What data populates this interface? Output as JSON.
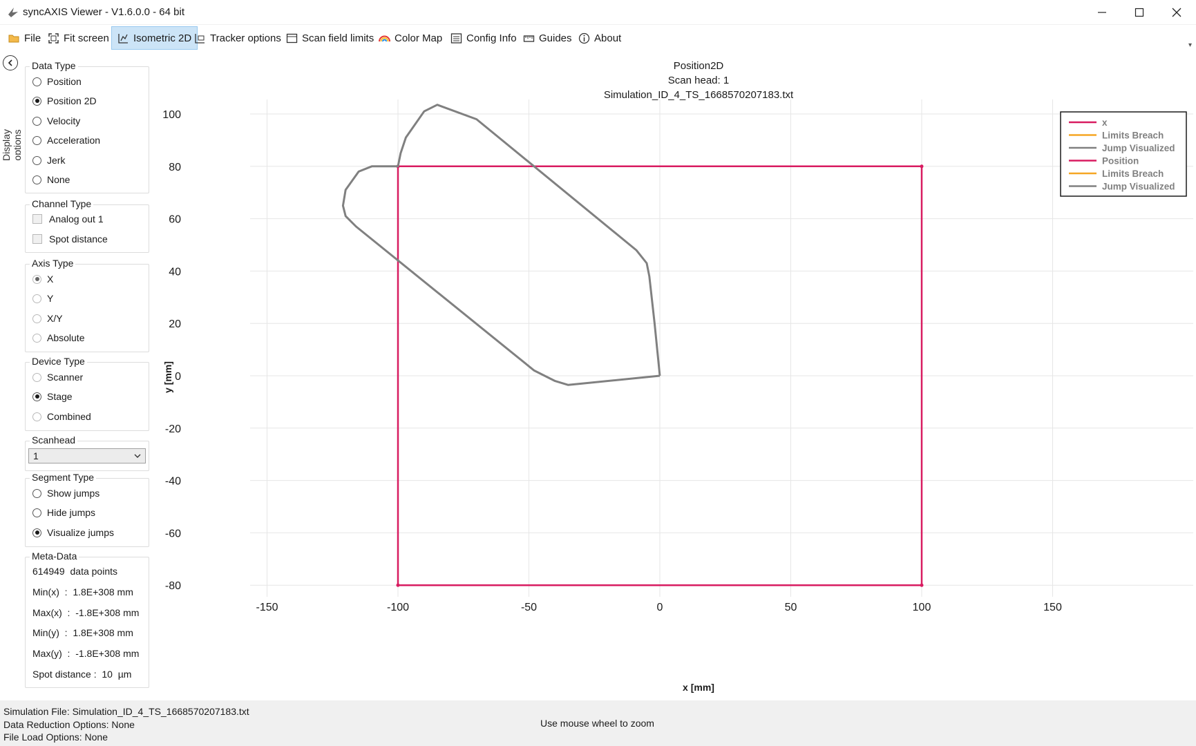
{
  "window": {
    "title": "syncAXIS Viewer - V1.6.0.0 - 64 bit"
  },
  "toolbar": {
    "file": "File",
    "fit_screen": "Fit screen",
    "isometric_2d": "Isometric 2D",
    "tracker_options": "Tracker options",
    "scan_field_limits": "Scan field limits",
    "color_map": "Color Map",
    "config_info": "Config Info",
    "guides": "Guides",
    "about": "About"
  },
  "sidebar": {
    "strip_label": "Display options",
    "data_type": {
      "title": "Data Type",
      "options": [
        "Position",
        "Position 2D",
        "Velocity",
        "Acceleration",
        "Jerk",
        "None"
      ],
      "selected": "Position 2D"
    },
    "channel_type": {
      "title": "Channel Type",
      "options": [
        "Analog out 1",
        "Spot distance"
      ]
    },
    "axis_type": {
      "title": "Axis Type",
      "options": [
        "X",
        "Y",
        "X/Y",
        "Absolute"
      ],
      "selected": "X"
    },
    "device_type": {
      "title": "Device Type",
      "options": [
        "Scanner",
        "Stage",
        "Combined"
      ],
      "selected": "Stage"
    },
    "scanhead": {
      "title": "Scanhead",
      "value": "1"
    },
    "segment_type": {
      "title": "Segment Type",
      "options": [
        "Show jumps",
        "Hide jumps",
        "Visualize jumps"
      ],
      "selected": "Visualize jumps"
    },
    "meta_data": {
      "title": "Meta-Data",
      "data_points": "614949  data points",
      "min_x": "Min(x)  :  1.8E+308 mm",
      "max_x": "Max(x)  :  -1.8E+308 mm",
      "min_y": "Min(y)  :  1.8E+308 mm",
      "max_y": "Max(y)  :  -1.8E+308 mm",
      "spot_distance": "Spot distance :  10  µm"
    }
  },
  "chart_data": {
    "type": "line",
    "title": "Position2D",
    "subtitle_lines": [
      "Scan head: 1",
      "Simulation_ID_4_TS_1668570207183.txt"
    ],
    "xlabel": "x [mm]",
    "ylabel": "y [mm]",
    "xlim": [
      -150,
      150
    ],
    "ylim": [
      -80,
      100
    ],
    "xticks": [
      -150,
      -100,
      -50,
      0,
      50,
      100,
      150
    ],
    "yticks": [
      100,
      80,
      60,
      40,
      20,
      0,
      -20,
      -40,
      -60,
      -80
    ],
    "grid": true,
    "legend_placement": "top-right",
    "legend": [
      {
        "label": "x",
        "color": "#d81b60"
      },
      {
        "label": "Limits Breach",
        "color": "#f5a623"
      },
      {
        "label": "Jump Visualized",
        "color": "#808080"
      },
      {
        "label": "Position",
        "color": "#d81b60"
      },
      {
        "label": "Limits Breach",
        "color": "#f5a623"
      },
      {
        "label": "Jump Visualized",
        "color": "#808080"
      }
    ],
    "series": [
      {
        "name": "Position",
        "color": "#d81b60",
        "points": [
          [
            -100,
            80
          ],
          [
            100,
            80
          ],
          [
            100,
            -80
          ],
          [
            -100,
            -80
          ],
          [
            -100,
            80
          ]
        ]
      },
      {
        "name": "Jump Visualized",
        "color": "#808080",
        "points": [
          [
            0,
            0
          ],
          [
            -2,
            20
          ],
          [
            -4,
            38
          ],
          [
            -5,
            43
          ],
          [
            -9,
            48
          ],
          [
            -70,
            98
          ],
          [
            -85,
            103.5
          ],
          [
            -90,
            101
          ],
          [
            -97,
            91
          ],
          [
            -99,
            85
          ],
          [
            -100,
            80
          ],
          [
            -110,
            80
          ],
          [
            -115,
            78
          ],
          [
            -120,
            71
          ],
          [
            -121,
            65
          ],
          [
            -120,
            61
          ],
          [
            -116,
            57
          ],
          [
            -48,
            2
          ],
          [
            -40,
            -2
          ],
          [
            -35,
            -3.5
          ],
          [
            -30,
            -3
          ],
          [
            0,
            0
          ]
        ]
      }
    ]
  },
  "status": {
    "simulation_file": "Simulation File: Simulation_ID_4_TS_1668570207183.txt",
    "data_reduction": "Data Reduction Options: None",
    "file_load": "File Load Options:  None",
    "hint": "Use mouse wheel to zoom"
  }
}
